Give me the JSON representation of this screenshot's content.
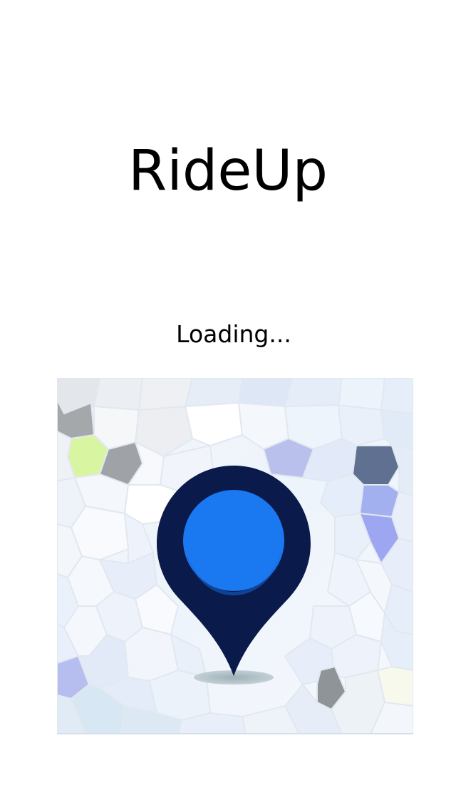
{
  "app": {
    "title": "RideUp",
    "loading_text": "Loading..."
  },
  "splash_image": {
    "icon": "location-pin-icon",
    "pin_outer_color": "#0a1a4a",
    "pin_inner_color": "#1a78f0",
    "background_colors": [
      "#ffffff",
      "#e8f1fb",
      "#dbe8f8",
      "#c9d6ee",
      "#a8b8e8",
      "#a6a6a6",
      "#d8f2a0",
      "#5f7090"
    ]
  }
}
